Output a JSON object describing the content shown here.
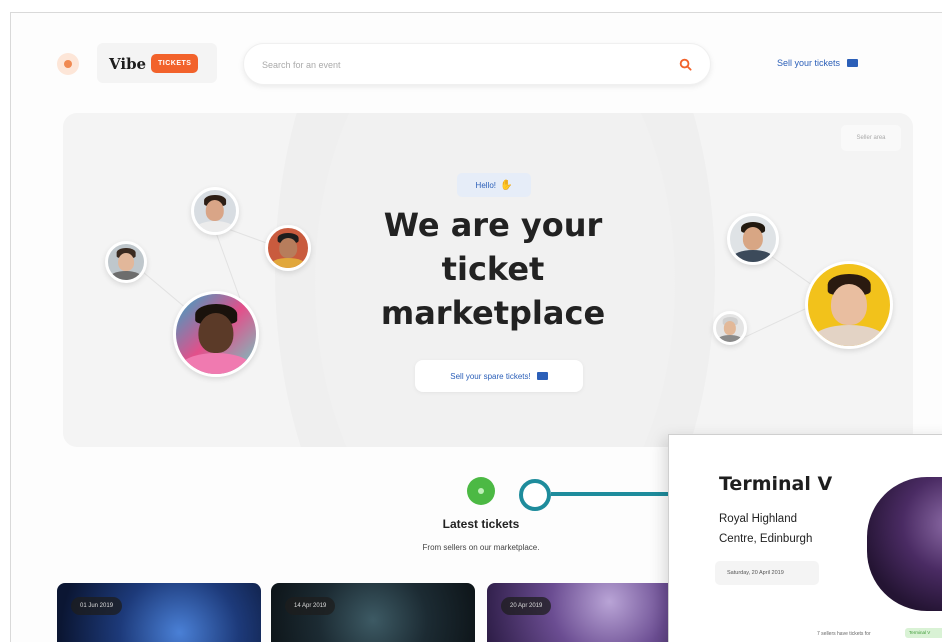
{
  "header": {
    "logo_text": "Vibe",
    "logo_badge": "TICKETS",
    "search_placeholder": "Search for an event",
    "sell_link": "Sell your tickets"
  },
  "hero": {
    "corner_label": "Seller area",
    "greeting": "Hello!",
    "title_line1": "We are your",
    "title_line2": "ticket",
    "title_line3": "marketplace",
    "cta": "Sell your spare tickets!"
  },
  "latest": {
    "title": "Latest tickets",
    "subtitle": "From sellers on our marketplace."
  },
  "tickets": [
    {
      "date": "01 Jun 2019"
    },
    {
      "date": "14 Apr 2019"
    },
    {
      "date": "20 Apr 2019"
    }
  ],
  "popup": {
    "title": "Terminal V",
    "venue_line1": "Royal Highland",
    "venue_line2": "Centre, Edinburgh",
    "date": "Saturday, 20 April 2019",
    "footer": "7 sellers have tickets for",
    "tag": "Terminal V"
  },
  "colors": {
    "accent_blue": "#2b5fb8",
    "brand_orange": "#f2622b",
    "step_green": "#4cb944",
    "connector_teal": "#1e8c9c"
  }
}
